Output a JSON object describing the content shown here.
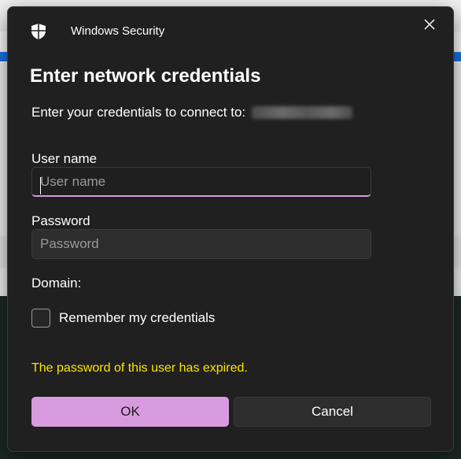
{
  "window": {
    "title": "Windows Security"
  },
  "dialog": {
    "heading": "Enter network credentials",
    "connect_prompt": "Enter your credentials to connect to:"
  },
  "fields": {
    "username_label": "User name",
    "username_placeholder": "User name",
    "username_value": "",
    "password_label": "Password",
    "password_placeholder": "Password",
    "password_value": "",
    "domain_label": "Domain:"
  },
  "remember": {
    "label": "Remember my credentials",
    "checked": false
  },
  "message": {
    "error": "The password of this user has expired.",
    "error_color": "#ffe400"
  },
  "buttons": {
    "ok_label": "OK",
    "cancel_label": "Cancel",
    "accent_color": "#d99bdf"
  },
  "icons": {
    "app_icon": "shield-icon",
    "close": "close-icon"
  }
}
